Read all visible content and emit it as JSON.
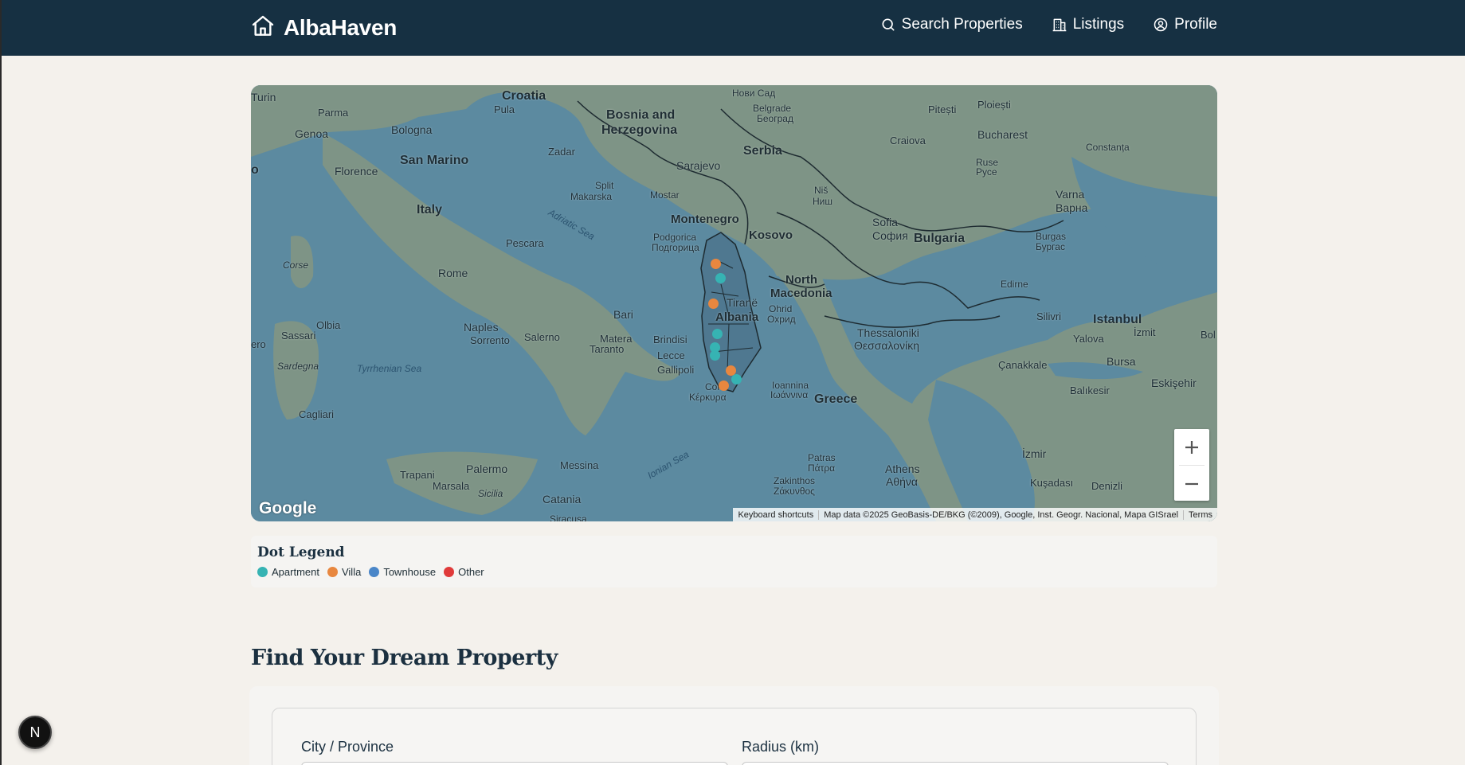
{
  "brand": {
    "name": "AlbaHaven"
  },
  "nav": [
    {
      "label": "Search Properties",
      "icon": "search-icon"
    },
    {
      "label": "Listings",
      "icon": "building-icon"
    },
    {
      "label": "Profile",
      "icon": "user-circle-icon"
    }
  ],
  "map": {
    "countries": {
      "croatia": "Croatia",
      "bosnia1": "Bosnia and",
      "bosnia2": "Herzegovina",
      "serbia": "Serbia",
      "italy": "Italy",
      "montenegro": "Montenegro",
      "kosovo": "Kosovo",
      "bulgaria": "Bulgaria",
      "north_mk1": "North",
      "north_mk2": "Macedonia",
      "albania": "Albania",
      "greece": "Greece",
      "sanmarino": "San Marino"
    },
    "cities": {
      "turin": "Turin",
      "parma": "Parma",
      "genoa": "Genoa",
      "bologna": "Bologna",
      "florence": "Florence",
      "pula": "Pula",
      "zadar": "Zadar",
      "split": "Split",
      "makarska": "Makarska",
      "mostar": "Mostar",
      "sarajevo": "Sarajevo",
      "novisad": "Нови Сад",
      "belgrade1": "Belgrade",
      "belgrade2": "Београд",
      "nis1": "Niš",
      "nis2": "Ниш",
      "pitesti": "Pitești",
      "ploiesti": "Ploiești",
      "craiova": "Craiova",
      "bucharest": "Bucharest",
      "constanta": "Constanța",
      "ruse1": "Ruse",
      "ruse2": "Русе",
      "varna1": "Varna",
      "varna2": "Варна",
      "sofia1": "Sofia",
      "sofia2": "София",
      "burgas1": "Burgas",
      "burgas2": "Бургас",
      "edirne": "Edirne",
      "podgorica1": "Podgorica",
      "podgorica2": "Подгорица",
      "pescara": "Pescara",
      "rome": "Rome",
      "corse": "Corse",
      "olbia": "Olbia",
      "sassari": "Sassari",
      "sardegna": "Sardegna",
      "cagliari": "Cagliari",
      "bari": "Bari",
      "naples": "Naples",
      "sorrento": "Sorrento",
      "salerno": "Salerno",
      "matera": "Matera",
      "taranto": "Taranto",
      "brindisi": "Brindisi",
      "lecce": "Lecce",
      "gallipoli": "Gallipoli",
      "tirane": "Tiranë",
      "ohrid1": "Ohrid",
      "ohrid2": "Охрид",
      "thessaloniki1": "Thessaloniki",
      "thessaloniki2": "Θεσσαλονίκη",
      "silivri": "Silivri",
      "istanbul": "Istanbul",
      "izmit": "İzmit",
      "yalova": "Yalova",
      "bursa": "Bursa",
      "canakkale": "Çanakkale",
      "balikesir": "Balıkesir",
      "eskisehir": "Eskişehir",
      "bolu": "Bol",
      "corfu1": "Cor",
      "corfu2": "Κέρκυρα",
      "ioannina1": "Ioannina",
      "ioannina2": "Ιωάννινα",
      "izmir": "İzmir",
      "kusadasi": "Kuşadası",
      "denizli": "Denizli",
      "athens1": "Athens",
      "athens2": "Αθήνα",
      "patras1": "Patras",
      "patras2": "Πάτρα",
      "zakinthos1": "Zakinthos",
      "zakinthos2": "Ζάκυνθος",
      "trapani": "Trapani",
      "marsala": "Marsala",
      "palermo": "Palermo",
      "sicilia": "Sicilia",
      "messina": "Messina",
      "catania": "Catania",
      "siracusa": "Siracusa",
      "edge_o": "o",
      "edge_ero": "ero"
    },
    "seas": {
      "adriatic": "Adriatic Sea",
      "tyrrhenian": "Tyrrhenian Sea",
      "ionian": "Ionian Sea"
    },
    "google": "Google",
    "attribution": [
      "Keyboard shortcuts",
      "Map data ©2025 GeoBasis-DE/BKG (©2009), Google, Inst. Geogr. Nacional, Mapa GISrael",
      "Terms"
    ],
    "colors": {
      "land": "#7e9486",
      "sea": "#5c8aa0",
      "albania": "#4f7890",
      "border": "#1d2a30"
    }
  },
  "legend": {
    "title": "Dot Legend",
    "items": [
      {
        "label": "Apartment",
        "color": "#36b3b3"
      },
      {
        "label": "Villa",
        "color": "#e8873f"
      },
      {
        "label": "Townhouse",
        "color": "#4a86c8"
      },
      {
        "label": "Other",
        "color": "#e03a3a"
      }
    ]
  },
  "section": {
    "title": "Find Your Dream Property"
  },
  "search": {
    "city_label": "City / Province",
    "radius_label": "Radius (km)"
  },
  "dev_badge": "N"
}
